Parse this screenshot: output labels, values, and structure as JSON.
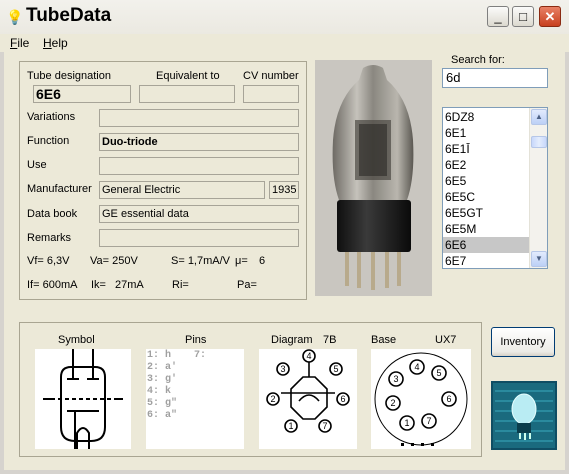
{
  "window": {
    "title": "TubeData",
    "minimize": "_",
    "maximize": "□",
    "close": "✕"
  },
  "menu": {
    "file_access": "F",
    "file_rest": "ile",
    "help_access": "H",
    "help_rest": "elp"
  },
  "form": {
    "tube_designation_label": "Tube designation",
    "equivalent_label": "Equivalent to",
    "cv_label": "CV number",
    "tube_designation": "6E6",
    "equivalent": "",
    "cv": "",
    "variations_label": "Variations",
    "variations": "",
    "function_label": "Function",
    "function": "Duo-triode",
    "use_label": "Use",
    "use": "",
    "manufacturer_label": "Manufacturer",
    "manufacturer": "General Electric",
    "year": "1935",
    "databook_label": "Data book",
    "databook": "GE essential data",
    "remarks_label": "Remarks",
    "remarks": "",
    "vf": "Vf= 6,3V",
    "va": "Va= 250V",
    "s": "S= 1,7mA/V",
    "mu": "μ=",
    "mu_val": "6",
    "if": "If= 600mA",
    "ik": "Ik=",
    "ik_val": "27mA",
    "ri": "Ri=",
    "pa": "Pa="
  },
  "search": {
    "label": "Search for:",
    "value": "6d",
    "results": [
      "6DZ8",
      "6E1",
      "6E1Ī",
      "6E2",
      "6E5",
      "6E5C",
      "6E5GT",
      "6E5M",
      "6E6",
      "6E7"
    ],
    "selected_index": 8
  },
  "bottom": {
    "symbol_label": "Symbol",
    "pins_label": "Pins",
    "diagram_label": "Diagram",
    "diagram_code": "7B",
    "base_label": "Base",
    "base_code": "UX7",
    "pins_col1": "1: h\n2: a'\n3: g'\n4: k\n5: g\"\n6: a\"",
    "pins_col2": "7:",
    "inventory_button": "Inventory"
  },
  "colors": {
    "close_red": "#c8401e",
    "selection": "#c7c7c7",
    "panel_bg": "#ece9d8",
    "photo_bg": "#c9c6c0"
  },
  "icons": {
    "app": "bulb-icon",
    "scroll_up": "arrow-up-icon",
    "scroll_down": "arrow-down-icon"
  }
}
